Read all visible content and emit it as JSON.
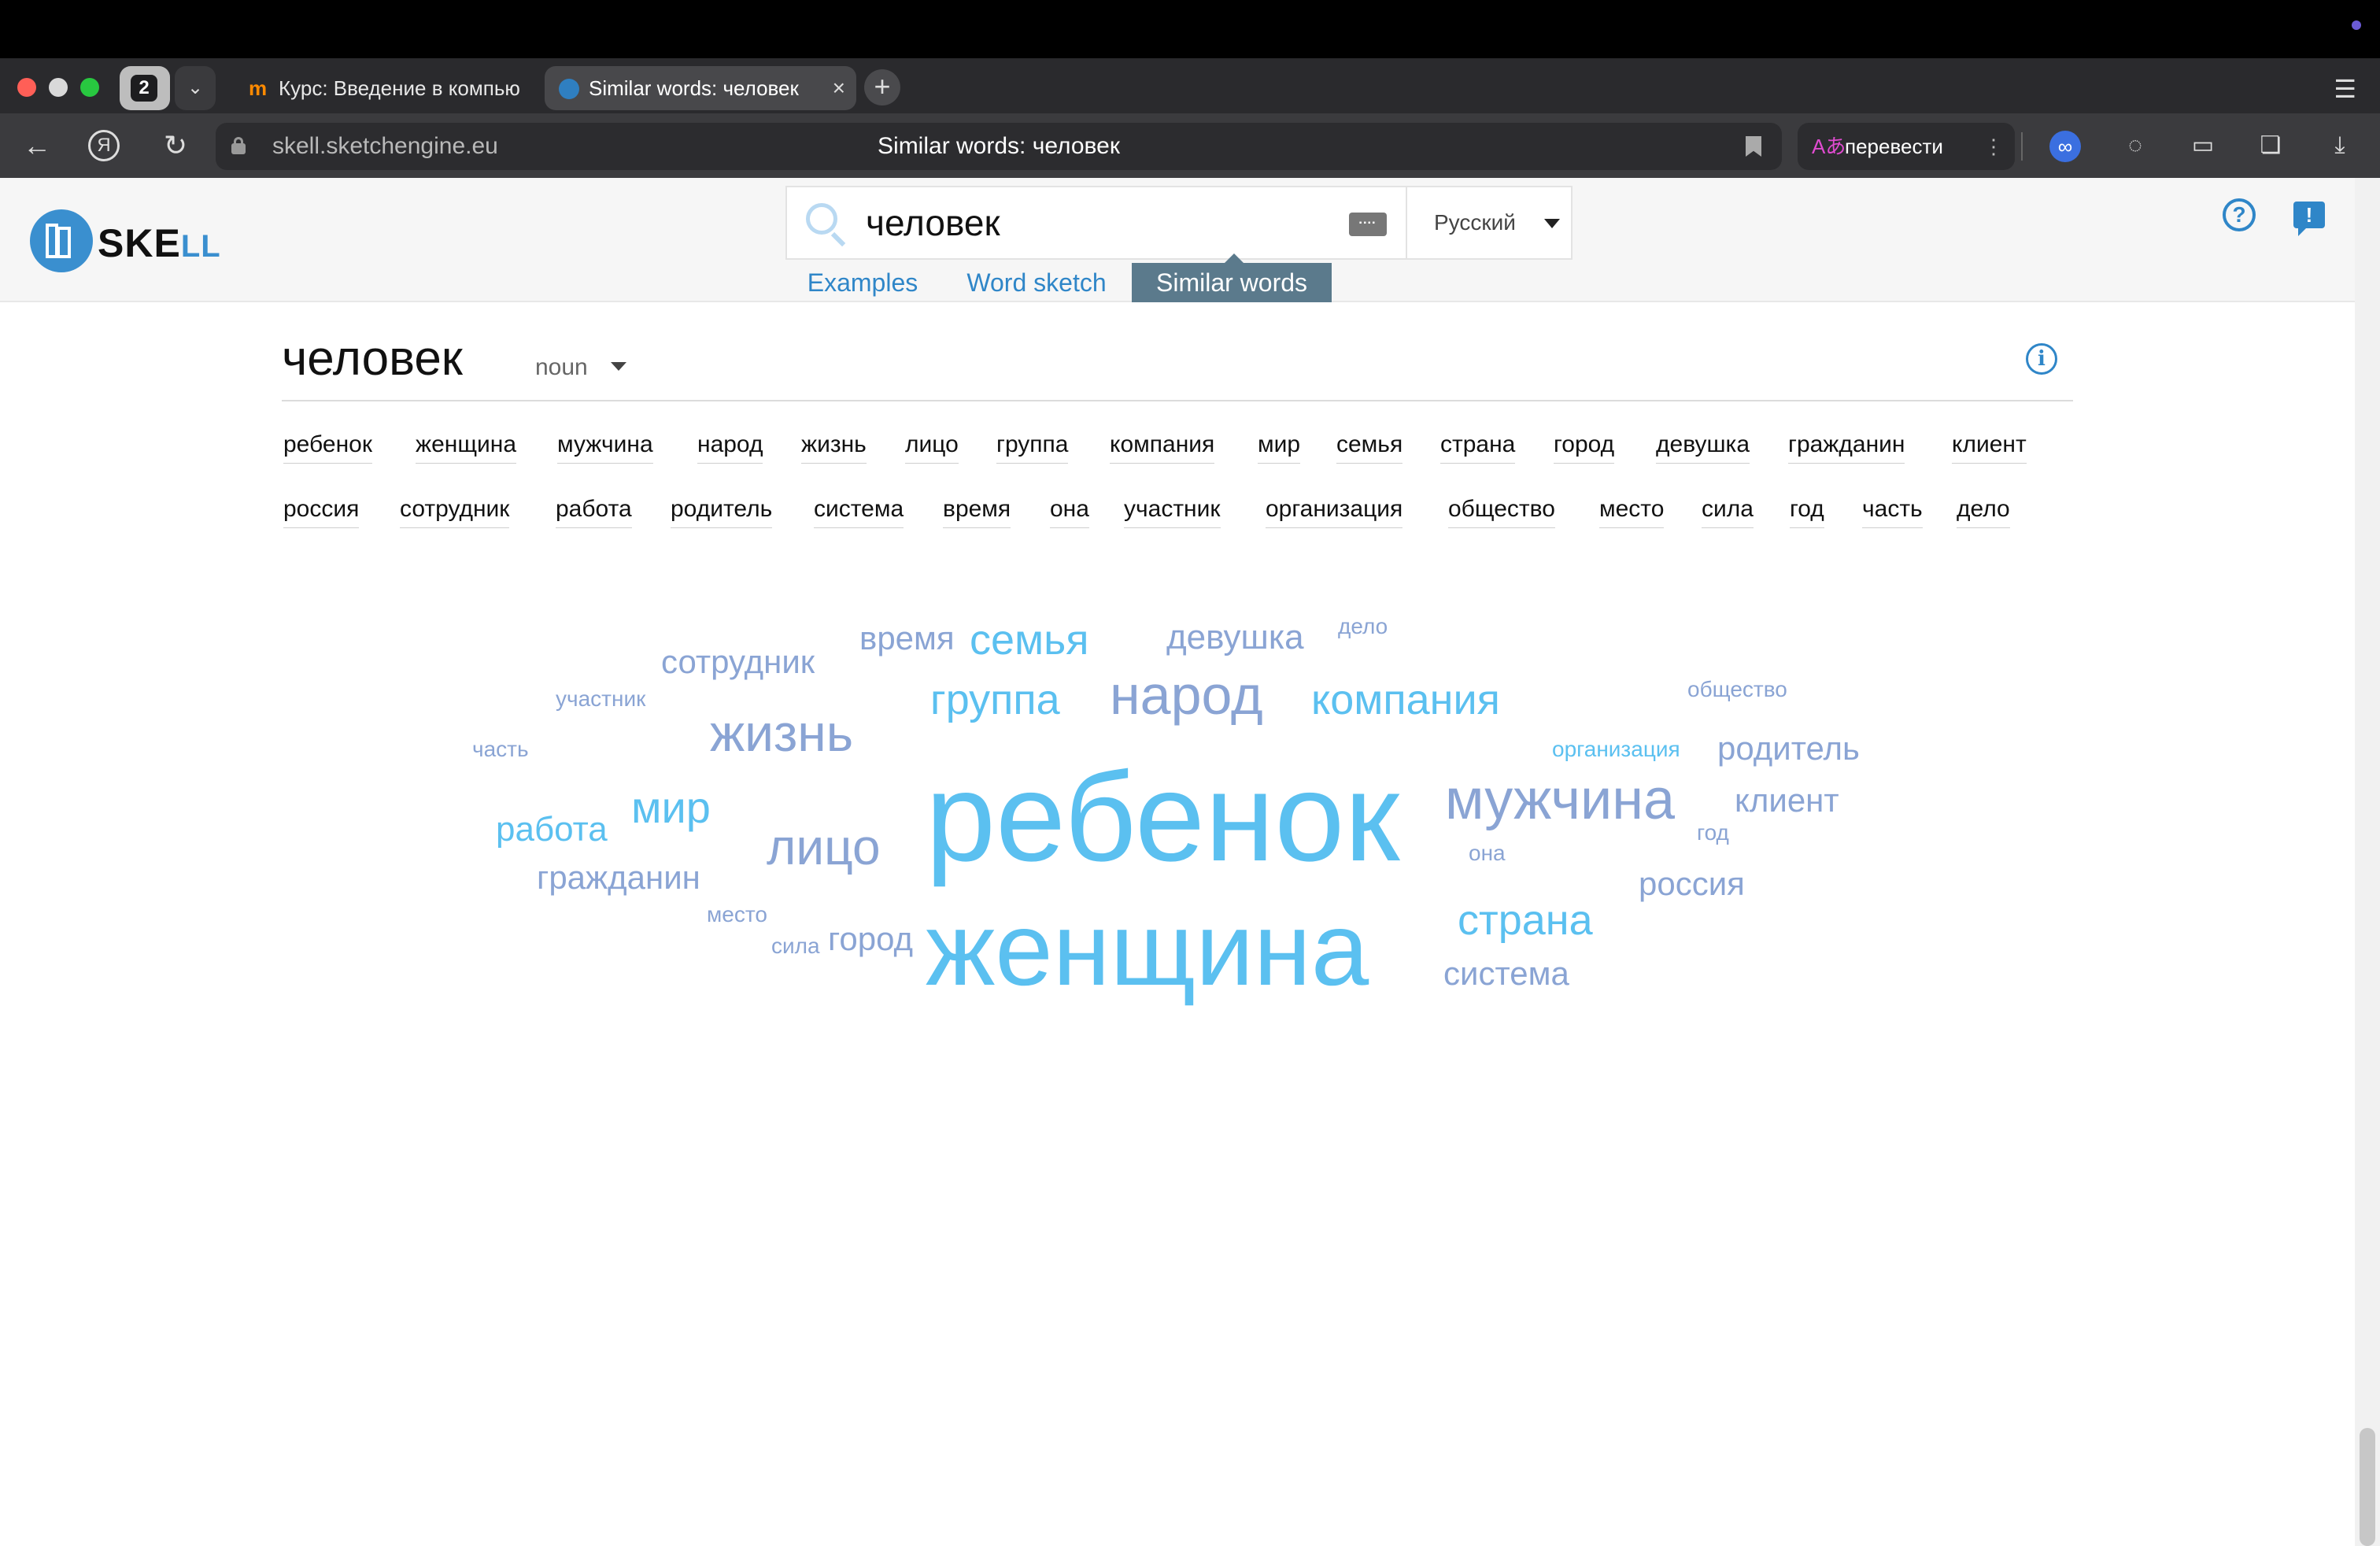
{
  "browser": {
    "tab_count": "2",
    "tabs": [
      {
        "title": "Курс: Введение в компью"
      },
      {
        "title": "Similar words: человек"
      }
    ],
    "url_domain": "skell.sketchengine.eu",
    "page_title": "Similar words: человек",
    "translate_label": "перевести"
  },
  "header": {
    "logo_main": "SKE",
    "logo_suffix": "LL",
    "search_value": "человек",
    "language": "Русский",
    "nav_tabs": {
      "examples": "Examples",
      "word_sketch": "Word sketch",
      "similar_words": "Similar words"
    },
    "active_tab": "similar_words"
  },
  "main": {
    "headword": "человек",
    "pos": "noun",
    "similar_words_row1": [
      "ребенок",
      "женщина",
      "мужчина",
      "народ",
      "жизнь",
      "лицо",
      "группа",
      "компания",
      "мир",
      "семья",
      "страна",
      "город",
      "девушка",
      "гражданин",
      "клиент"
    ],
    "similar_words_row2": [
      "россия",
      "сотрудник",
      "работа",
      "родитель",
      "система",
      "время",
      "она",
      "участник",
      "организация",
      "общество",
      "место",
      "сила",
      "год",
      "часть",
      "дело"
    ]
  },
  "word_cloud": [
    {
      "word": "ребенок",
      "rank": 1
    },
    {
      "word": "женщина",
      "rank": 2
    },
    {
      "word": "мужчина",
      "rank": 3
    },
    {
      "word": "народ",
      "rank": 4
    },
    {
      "word": "жизнь",
      "rank": 5
    },
    {
      "word": "лицо",
      "rank": 6
    },
    {
      "word": "группа",
      "rank": 7
    },
    {
      "word": "компания",
      "rank": 8
    },
    {
      "word": "мир",
      "rank": 9
    },
    {
      "word": "семья",
      "rank": 10
    },
    {
      "word": "страна",
      "rank": 11
    },
    {
      "word": "город",
      "rank": 12
    },
    {
      "word": "девушка",
      "rank": 13
    },
    {
      "word": "гражданин",
      "rank": 14
    },
    {
      "word": "клиент",
      "rank": 15
    },
    {
      "word": "россия",
      "rank": 16
    },
    {
      "word": "сотрудник",
      "rank": 17
    },
    {
      "word": "работа",
      "rank": 18
    },
    {
      "word": "родитель",
      "rank": 19
    },
    {
      "word": "система",
      "rank": 20
    },
    {
      "word": "время",
      "rank": 21
    },
    {
      "word": "она",
      "rank": 22
    },
    {
      "word": "участник",
      "rank": 23
    },
    {
      "word": "организация",
      "rank": 24
    },
    {
      "word": "общество",
      "rank": 25
    },
    {
      "word": "место",
      "rank": 26
    },
    {
      "word": "сила",
      "rank": 27
    },
    {
      "word": "год",
      "rank": 28
    },
    {
      "word": "часть",
      "rank": 29
    },
    {
      "word": "дело",
      "rank": 30
    }
  ],
  "colors": {
    "accent": "#2f86c8",
    "active_tab": "#5b7a8c",
    "cloud_blue": "#5bc0f0",
    "cloud_grey": "#8aa4d4"
  }
}
